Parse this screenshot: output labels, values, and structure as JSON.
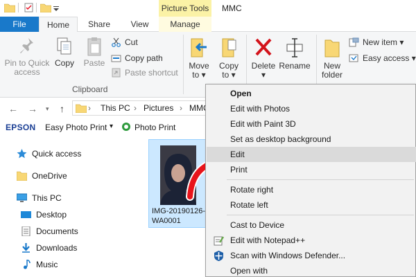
{
  "window": {
    "context_tab_label": "Picture Tools",
    "title": "MMC"
  },
  "tabs": {
    "file": "File",
    "home": "Home",
    "share": "Share",
    "view": "View",
    "manage": "Manage"
  },
  "ribbon": {
    "pin_line1": "Pin to Quick",
    "pin_line2": "access",
    "copy": "Copy",
    "paste": "Paste",
    "cut": "Cut",
    "copy_path": "Copy path",
    "paste_shortcut": "Paste shortcut",
    "clipboard_label": "Clipboard",
    "move_line1": "Move",
    "move_line2": "to",
    "copy_to_line1": "Copy",
    "copy_to_line2": "to",
    "delete": "Delete",
    "rename": "Rename",
    "new_folder_line1": "New",
    "new_folder_line2": "folder",
    "new_item": "New item",
    "easy_access": "Easy access",
    "dropdown_glyph": "▾"
  },
  "address": {
    "crumbs": [
      "This PC",
      "Pictures",
      "MMC"
    ],
    "separator": "›"
  },
  "epson": {
    "brand": "EPSON",
    "easy_photo_print": "Easy Photo Print",
    "photo_print": "Photo Print"
  },
  "nav": {
    "quick_access": "Quick access",
    "onedrive": "OneDrive",
    "this_pc": "This PC",
    "desktop": "Desktop",
    "documents": "Documents",
    "downloads": "Downloads",
    "music": "Music"
  },
  "file": {
    "name": "IMG-20190126-WA0001"
  },
  "context_menu": {
    "items": [
      "Open",
      "Edit with Photos",
      "Edit with Paint 3D",
      "Set as desktop background",
      "Edit",
      "Print",
      "Rotate right",
      "Rotate left",
      "Cast to Device",
      "Edit with Notepad++",
      "Scan with Windows Defender...",
      "Open with"
    ]
  },
  "colors": {
    "accent": "#1979ca",
    "context_tab": "#fbf2a6",
    "selection": "#cce8ff",
    "arrow": "#e8141b",
    "folder": "#f8d775"
  }
}
